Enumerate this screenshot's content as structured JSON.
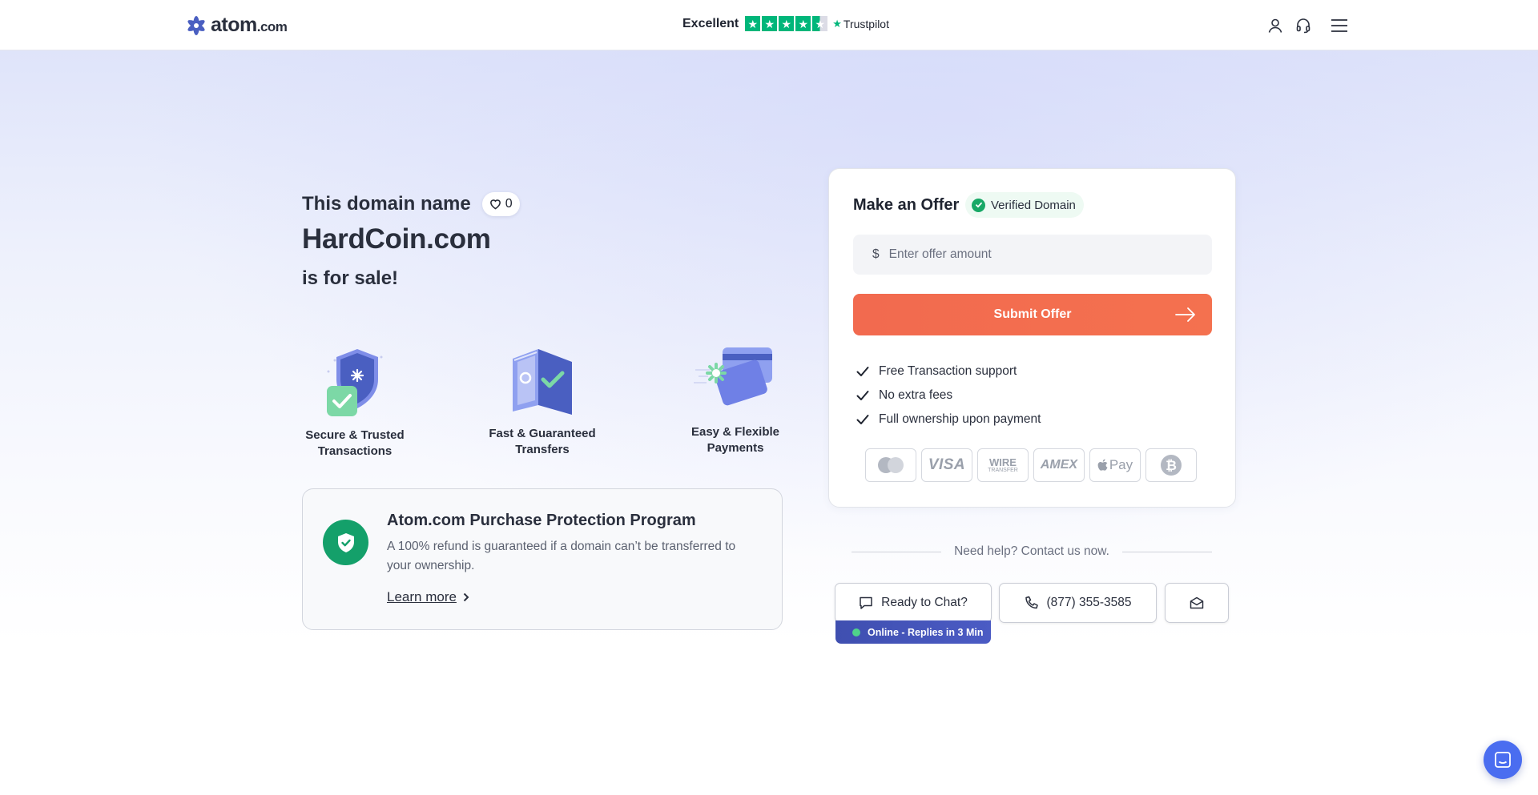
{
  "header": {
    "logo_main": "atom",
    "logo_tld": ".com",
    "rating_word": "Excellent",
    "rating_brand": "Trustpilot",
    "rating_stars": 4.5,
    "icons": [
      "user-icon",
      "headset-icon",
      "menu-icon"
    ]
  },
  "hero": {
    "intro": "This domain name",
    "likes": "0",
    "domain": "HardCoin.com",
    "suffix": "is for sale!"
  },
  "features": [
    {
      "label_line1": "Secure & Trusted",
      "label_line2": "Transactions",
      "icon": "shield-check-icon"
    },
    {
      "label_line1": "Fast & Guaranteed",
      "label_line2": "Transfers",
      "icon": "transfer-icon"
    },
    {
      "label_line1": "Easy & Flexible",
      "label_line2": "Payments",
      "icon": "cards-icon"
    }
  ],
  "protection": {
    "title": "Atom.com Purchase Protection Program",
    "text": "A 100% refund is guaranteed if a domain can’t be transferred to your ownership.",
    "link": "Learn more"
  },
  "offer": {
    "title": "Make an Offer",
    "badge": "Verified Domain",
    "currency": "$",
    "placeholder": "Enter offer amount",
    "submit": "Submit Offer",
    "benefits": [
      "Free Transaction support",
      "No extra fees",
      "Full ownership upon payment"
    ],
    "payment_methods": [
      "mastercard-icon",
      "visa-icon",
      "wire-transfer-icon",
      "amex-icon",
      "apple-pay-icon",
      "bitcoin-icon"
    ],
    "payment_labels": {
      "visa": "VISA",
      "wire": "WIRE",
      "wire_sub": "TRANSFER",
      "amex": "AMEX",
      "applepay": "Pay"
    }
  },
  "help": {
    "text": "Need help? Contact us now.",
    "chat": "Ready to Chat?",
    "phone": "(877) 355-3585",
    "online": "Online - Replies in 3 Min"
  },
  "colors": {
    "accent": "#f26a4f",
    "success": "#14a06a",
    "brand": "#4a5fc1",
    "trustpilot": "#00b67a"
  }
}
